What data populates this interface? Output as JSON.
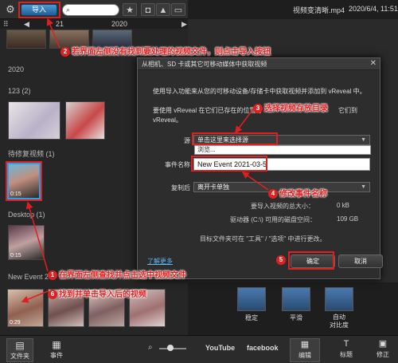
{
  "toolbar": {
    "import_label": "导入",
    "search_placeholder": "",
    "icons": [
      "gear-icon",
      "star-icon",
      "camera-icon",
      "landscape-icon",
      "monitor-icon"
    ]
  },
  "timeline": {
    "left": "21",
    "right": "2020"
  },
  "library": {
    "year_label": "2020",
    "group1_label": "123 (2)",
    "group2_label": "待修复视频 (1)",
    "group3_label": "Desktop (1)",
    "group4_label": "New Event 20",
    "thumb_durations": [
      "0:15",
      "0:15",
      "0:29"
    ]
  },
  "left_bottom": {
    "folder_label": "文件夹",
    "event_label": "事件"
  },
  "right_panel": {
    "title_file": "视频变清晰.mp4",
    "title_date": "2020/6/4, 11:51",
    "effects": [
      "稳定",
      "平滑",
      "自动\n对比度"
    ],
    "bottom_labels": {
      "youtube": "YouTube",
      "facebook": "facebook",
      "edit": "编辑",
      "title": "标题",
      "fix": "修正"
    }
  },
  "dialog": {
    "title": "从相机、SD 卡或其它可移动媒体中获取视频",
    "intro": "使用导入功能来从您的可移动设备/存储卡中获取视频并添加到 vReveal 中。",
    "intro2_a": "要使用 vReveal 在它们已存在的位置打",
    "intro2_b": "它们到",
    "intro2_c": "vReveal。",
    "source_label": "源",
    "source_value": "单击这里来选择源",
    "browse_option": "浏览...",
    "event_label": "事件名称",
    "event_value": "New Event 2021-03-5",
    "after_copy_label": "复制后",
    "after_copy_value": "离开卡单独",
    "total_size_label": "要导入视频的总大小：",
    "total_size_value": "0 kB",
    "drive_label": "驱动器 (C:\\) 可用的磁盘空间：",
    "drive_value": "109 GB",
    "note": "目标文件夹可在 \"工具\" / \"选项\" 中进行更改。",
    "learn_more": "了解更多",
    "ok_label": "确定",
    "cancel_label": "取消"
  },
  "annotations": {
    "n1": "1",
    "t1": "在界面左侧查找并点击选中视频文件",
    "n2": "2",
    "t2": "若界面左侧没有找到要处理的视频文件，则点击导入按钮",
    "n3": "3",
    "t3": "选择视频存放目录",
    "n4": "4",
    "t4": "修改事件名称",
    "n5": "5",
    "n6": "6",
    "t6": "找到并单击导入后的视频"
  },
  "colors": {
    "accent": "#2aa0e6",
    "annotation_red": "#e02020",
    "background": "#1b1b1b"
  }
}
